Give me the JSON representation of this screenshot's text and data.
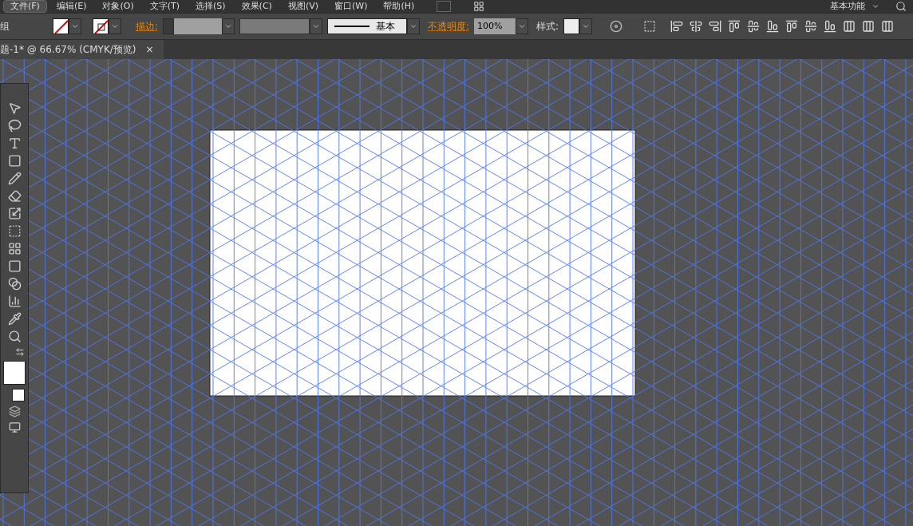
{
  "menu": [
    {
      "label": "文件(F)",
      "selected": true
    },
    {
      "label": "编辑(E)",
      "selected": false
    },
    {
      "label": "对象(O)",
      "selected": false
    },
    {
      "label": "文字(T)",
      "selected": false
    },
    {
      "label": "选择(S)",
      "selected": false
    },
    {
      "label": "效果(C)",
      "selected": false
    },
    {
      "label": "视图(V)",
      "selected": false
    },
    {
      "label": "窗口(W)",
      "selected": false
    },
    {
      "label": "帮助(H)",
      "selected": false
    }
  ],
  "workspace": "基本功能",
  "control_bar": {
    "selection_label": "组",
    "stroke_label": "描边:",
    "stroke_profile": "基本",
    "opacity_label": "不透明度:",
    "opacity_value": "100%",
    "style_label": "样式:"
  },
  "document_tab": {
    "title": "题-1* @ 66.67% (CMYK/预览)",
    "close": "×"
  }
}
